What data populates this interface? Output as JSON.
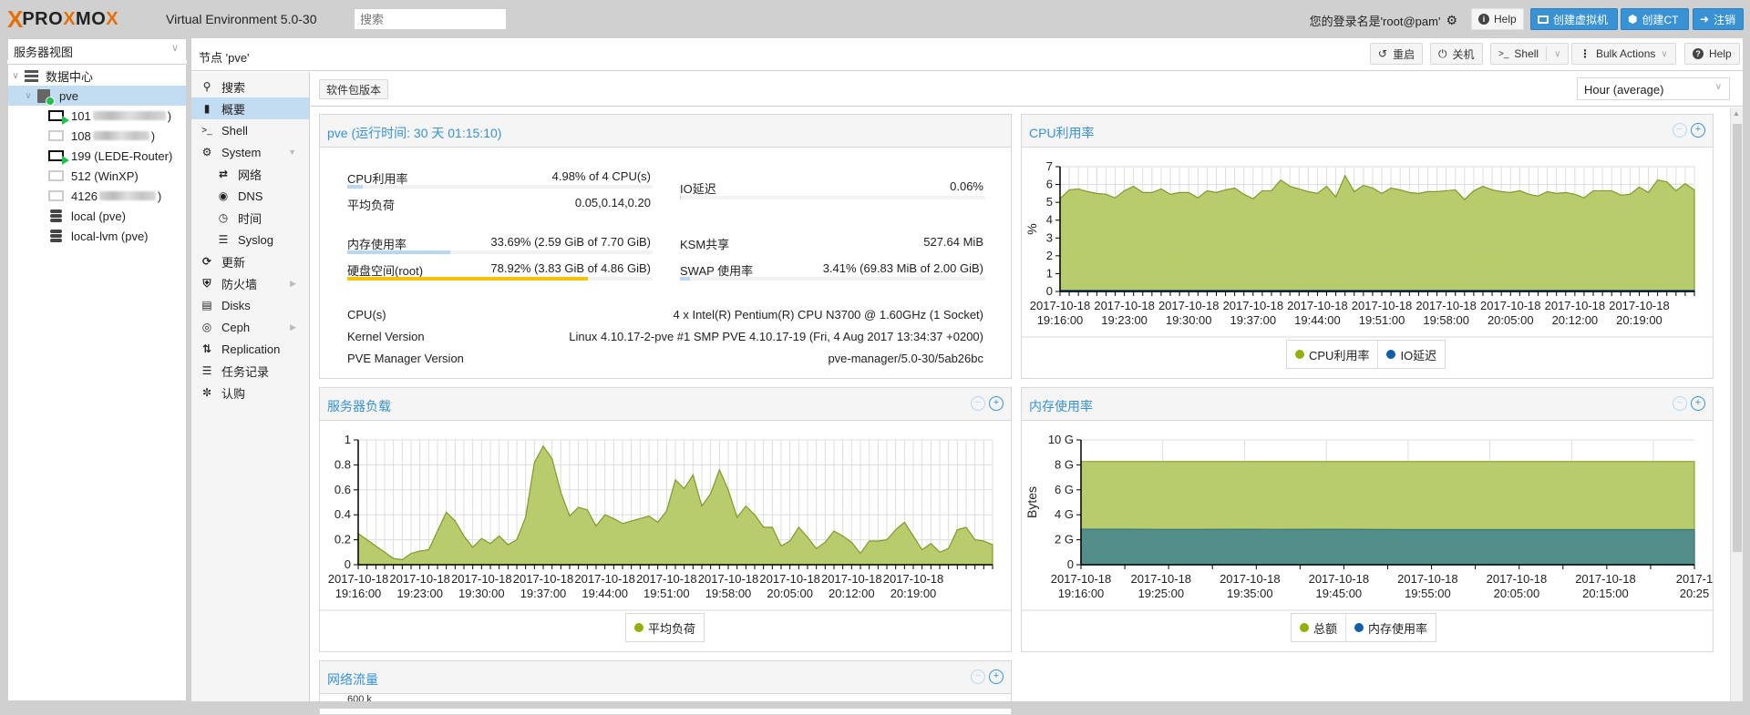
{
  "header": {
    "brand_x": "X",
    "brand_pro": "PRO",
    "brand_mo": "MO",
    "brand_x2": "X",
    "version": "Virtual Environment 5.0-30",
    "search_placeholder": "搜索",
    "login_text": "您的登录名是'root@pam'",
    "help_label": "Help",
    "create_vm_label": "创建虚拟机",
    "create_ct_label": "创建CT",
    "logout_label": "注销"
  },
  "tree": {
    "view_label": "服务器视图",
    "items": [
      {
        "label": "数据中心",
        "icon": "datacenter-icon"
      },
      {
        "label": "pve",
        "icon": "node-online-icon",
        "selected": true
      },
      {
        "label": "101",
        "suffix": ")",
        "icon": "vm-running-icon",
        "blurred": true
      },
      {
        "label": "108",
        "suffix": ")",
        "icon": "vm-stopped-icon",
        "blurred": true
      },
      {
        "label": "199 (LEDE-Router)",
        "icon": "vm-running-icon"
      },
      {
        "label": "512 (WinXP)",
        "icon": "vm-stopped-icon"
      },
      {
        "label": "4126",
        "suffix": ")",
        "icon": "vm-stopped-icon",
        "blurred": true
      },
      {
        "label": "local (pve)",
        "icon": "storage-icon"
      },
      {
        "label": "local-lvm (pve)",
        "icon": "storage-icon"
      }
    ]
  },
  "node": {
    "title": "节点 'pve'",
    "toolbar": {
      "reboot": "重启",
      "shutdown": "关机",
      "shell": "Shell",
      "bulk": "Bulk Actions",
      "help": "Help"
    },
    "nav": [
      {
        "label": "搜索",
        "icon": "search-icon"
      },
      {
        "label": "概要",
        "icon": "book-icon",
        "selected": true
      },
      {
        "label": "Shell",
        "icon": "terminal-icon"
      },
      {
        "label": "System",
        "icon": "cogs-icon",
        "expandable": "down"
      },
      {
        "label": "网络",
        "icon": "exchange-icon",
        "sub": true
      },
      {
        "label": "DNS",
        "icon": "globe-icon",
        "sub": true
      },
      {
        "label": "时间",
        "icon": "clock-icon",
        "sub": true
      },
      {
        "label": "Syslog",
        "icon": "list-icon",
        "sub": true
      },
      {
        "label": "更新",
        "icon": "refresh-icon"
      },
      {
        "label": "防火墙",
        "icon": "shield-icon",
        "expandable": "right"
      },
      {
        "label": "Disks",
        "icon": "hdd-icon"
      },
      {
        "label": "Ceph",
        "icon": "ceph-icon",
        "expandable": "right"
      },
      {
        "label": "Replication",
        "icon": "retweet-icon"
      },
      {
        "label": "任务记录",
        "icon": "list-icon"
      },
      {
        "label": "认购",
        "icon": "support-icon"
      }
    ],
    "pkg_versions_label": "软件包版本",
    "timeframe": "Hour (average)"
  },
  "summary": {
    "title": "pve (运行时间: 30 天 01:15:10)",
    "cpu_label": "CPU利用率",
    "cpu_value": "4.98% of 4 CPU(s)",
    "cpu_fraction": 0.0498,
    "load_label": "平均负荷",
    "load_value": "0.05,0.14,0.20",
    "io_label": "IO延迟",
    "io_value": "0.06%",
    "io_fraction": 0.0006,
    "mem_label": "内存使用率",
    "mem_value": "33.69% (2.59 GiB of 7.70 GiB)",
    "mem_fraction": 0.3369,
    "ksm_label": "KSM共享",
    "ksm_value": "527.64 MiB",
    "disk_label": "硬盘空间(root)",
    "disk_value": "78.92% (3.83 GiB of 4.86 GiB)",
    "disk_fraction": 0.7892,
    "swap_label": "SWAP 使用率",
    "swap_value": "3.41% (69.83 MiB of 2.00 GiB)",
    "swap_fraction": 0.0341,
    "cpus_label": "CPU(s)",
    "cpus_value": "4 x Intel(R) Pentium(R) CPU N3700 @ 1.60GHz (1 Socket)",
    "kernel_label": "Kernel Version",
    "kernel_value": "Linux 4.10.17-2-pve #1 SMP PVE 4.10.17-19 (Fri, 4 Aug 2017 13:34:37 +0200)",
    "pvemgr_label": "PVE Manager Version",
    "pvemgr_value": "pve-manager/5.0-30/5ab26bc"
  },
  "panels": {
    "network_title": "网络流量",
    "network_partial_tick": "600 k"
  },
  "colors": {
    "accent": "#3892d4",
    "area_green": "#b5c965",
    "area_green_line": "#7e9a2a",
    "area_teal": "#4e8a8c",
    "legend_green": "#94ae0a",
    "legend_blue": "#115fa6",
    "disk_warn": "#f5c400"
  },
  "chart_data": [
    {
      "id": "cpu",
      "type": "area",
      "title": "CPU利用率",
      "ylabel": "%",
      "ylim": [
        0,
        7
      ],
      "yticks": [
        "0",
        "1",
        "2",
        "3",
        "4",
        "5",
        "6",
        "7"
      ],
      "xtick_labels": [
        [
          "2017-10-18",
          "19:16:00"
        ],
        [
          "2017-10-18",
          "19:23:00"
        ],
        [
          "2017-10-18",
          "19:30:00"
        ],
        [
          "2017-10-18",
          "19:37:00"
        ],
        [
          "2017-10-18",
          "19:44:00"
        ],
        [
          "2017-10-18",
          "19:51:00"
        ],
        [
          "2017-10-18",
          "19:58:00"
        ],
        [
          "2017-10-18",
          "20:05:00"
        ],
        [
          "2017-10-18",
          "20:12:00"
        ],
        [
          "2017-10-18",
          "20:19:00"
        ]
      ],
      "legend": [
        {
          "name": "CPU利用率",
          "color": "#94ae0a"
        },
        {
          "name": "IO延迟",
          "color": "#115fa6"
        }
      ],
      "grid": true,
      "series": [
        {
          "name": "CPU利用率",
          "values": [
            5.2,
            5.7,
            5.75,
            5.6,
            5.5,
            5.45,
            5.25,
            5.65,
            5.9,
            5.55,
            5.55,
            5.75,
            5.45,
            5.55,
            5.55,
            5.25,
            5.65,
            5.55,
            5.7,
            5.8,
            5.45,
            5.2,
            5.65,
            5.65,
            6.25,
            5.9,
            5.75,
            5.6,
            5.5,
            5.9,
            5.3,
            6.5,
            5.6,
            5.95,
            5.8,
            5.5,
            5.8,
            5.7,
            5.55,
            5.5,
            5.6,
            5.6,
            5.65,
            5.7,
            5.15,
            5.65,
            5.9,
            5.7,
            5.6,
            5.55,
            5.65,
            5.45,
            5.35,
            5.6,
            5.5,
            5.55,
            5.45,
            5.25,
            5.65,
            5.65,
            5.65,
            5.4,
            5.45,
            5.85,
            5.55,
            6.25,
            6.15,
            5.65,
            6.05,
            5.7
          ]
        },
        {
          "name": "IO延迟",
          "values": [
            0.06,
            0.06,
            0.06,
            0.06,
            0.06,
            0.06,
            0.06,
            0.06,
            0.06,
            0.06,
            0.06,
            0.06,
            0.06,
            0.06,
            0.06,
            0.06,
            0.06,
            0.06,
            0.06,
            0.06,
            0.06,
            0.06,
            0.06,
            0.06,
            0.06,
            0.06,
            0.06,
            0.06,
            0.06,
            0.06,
            0.06,
            0.06,
            0.06,
            0.06,
            0.06,
            0.06,
            0.06,
            0.06,
            0.06,
            0.06,
            0.06,
            0.06,
            0.06,
            0.06,
            0.06,
            0.06,
            0.06,
            0.06,
            0.06,
            0.06,
            0.06,
            0.06,
            0.06,
            0.06,
            0.06,
            0.06,
            0.06,
            0.06,
            0.06,
            0.06,
            0.06,
            0.06,
            0.06,
            0.06,
            0.06,
            0.06,
            0.06,
            0.06,
            0.06,
            0.06
          ]
        }
      ]
    },
    {
      "id": "load",
      "type": "area",
      "title": "服务器负载",
      "ylabel": "",
      "ylim": [
        0,
        1
      ],
      "yticks": [
        "0",
        "0.2",
        "0.4",
        "0.6",
        "0.8",
        "1"
      ],
      "xtick_labels": [
        [
          "2017-10-18",
          "19:16:00"
        ],
        [
          "2017-10-18",
          "19:23:00"
        ],
        [
          "2017-10-18",
          "19:30:00"
        ],
        [
          "2017-10-18",
          "19:37:00"
        ],
        [
          "2017-10-18",
          "19:44:00"
        ],
        [
          "2017-10-18",
          "19:51:00"
        ],
        [
          "2017-10-18",
          "19:58:00"
        ],
        [
          "2017-10-18",
          "20:05:00"
        ],
        [
          "2017-10-18",
          "20:12:00"
        ],
        [
          "2017-10-18",
          "20:19:00"
        ]
      ],
      "legend": [
        {
          "name": "平均负荷",
          "color": "#94ae0a"
        }
      ],
      "grid": true,
      "series": [
        {
          "name": "平均负荷",
          "values": [
            0.25,
            0.2,
            0.15,
            0.1,
            0.05,
            0.04,
            0.09,
            0.11,
            0.12,
            0.27,
            0.42,
            0.35,
            0.23,
            0.14,
            0.21,
            0.17,
            0.23,
            0.16,
            0.2,
            0.38,
            0.82,
            0.95,
            0.85,
            0.58,
            0.39,
            0.46,
            0.44,
            0.31,
            0.4,
            0.37,
            0.33,
            0.35,
            0.37,
            0.39,
            0.34,
            0.43,
            0.68,
            0.61,
            0.72,
            0.47,
            0.57,
            0.76,
            0.6,
            0.38,
            0.47,
            0.4,
            0.3,
            0.3,
            0.15,
            0.19,
            0.3,
            0.22,
            0.13,
            0.18,
            0.27,
            0.23,
            0.18,
            0.09,
            0.19,
            0.19,
            0.2,
            0.28,
            0.34,
            0.23,
            0.12,
            0.17,
            0.1,
            0.13,
            0.28,
            0.3,
            0.2,
            0.19,
            0.16
          ]
        }
      ]
    },
    {
      "id": "memory",
      "type": "area",
      "title": "内存使用率",
      "ylabel": "Bytes",
      "ylim": [
        0,
        10
      ],
      "yticks": [
        "0",
        "2 G",
        "4 G",
        "6 G",
        "8 G",
        "10 G"
      ],
      "xtick_labels": [
        [
          "2017-10-18",
          "19:16:00"
        ],
        [
          "2017-10-18",
          "19:25:00"
        ],
        [
          "2017-10-18",
          "19:35:00"
        ],
        [
          "2017-10-18",
          "19:45:00"
        ],
        [
          "2017-10-18",
          "19:55:00"
        ],
        [
          "2017-10-18",
          "20:05:00"
        ],
        [
          "2017-10-18",
          "20:15:00"
        ],
        [
          "2017-1",
          "20:25"
        ]
      ],
      "legend": [
        {
          "name": "总额",
          "color": "#94ae0a"
        },
        {
          "name": "内存使用率",
          "color": "#115fa6"
        }
      ],
      "grid": true,
      "series": [
        {
          "name": "总额",
          "values": [
            8.27,
            8.27,
            8.27,
            8.27,
            8.27,
            8.27,
            8.27,
            8.27,
            8.27,
            8.27,
            8.27,
            8.27,
            8.27,
            8.27,
            8.27,
            8.27
          ]
        },
        {
          "name": "内存使用率",
          "values": [
            2.85,
            2.85,
            2.83,
            2.83,
            2.84,
            2.83,
            2.84,
            2.83,
            2.81,
            2.81,
            2.81,
            2.81,
            2.81,
            2.81,
            2.81,
            2.81
          ]
        }
      ]
    }
  ]
}
